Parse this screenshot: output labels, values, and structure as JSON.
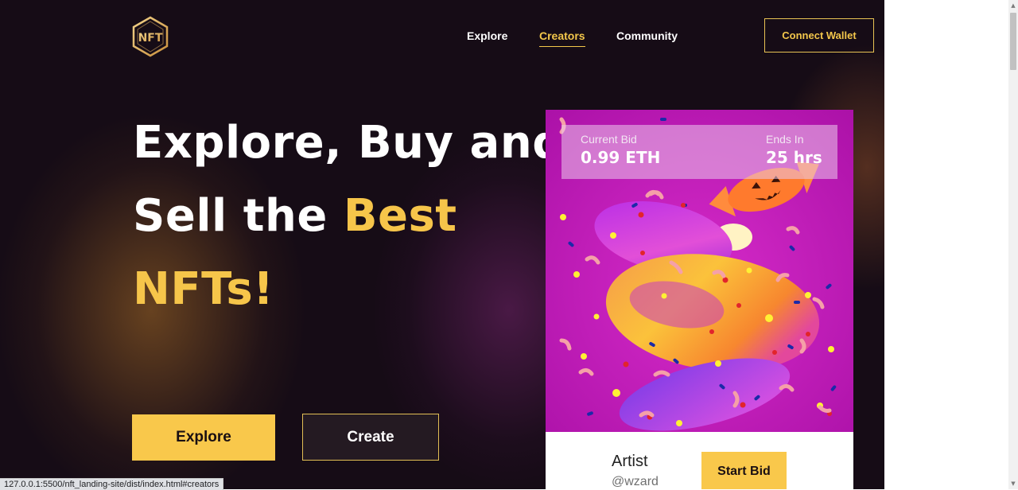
{
  "header": {
    "logo_text": "NFT",
    "nav": [
      {
        "label": "Explore",
        "active": false
      },
      {
        "label": "Creators",
        "active": true
      },
      {
        "label": "Community",
        "active": false
      }
    ],
    "connect_label": "Connect Wallet"
  },
  "hero": {
    "line1": "Explore, Buy and",
    "line2_plain": "Sell the ",
    "line2_highlight": "Best",
    "line3": "NFTs!",
    "explore_label": "Explore",
    "create_label": "Create"
  },
  "card": {
    "current_bid_label": "Current Bid",
    "current_bid_value": "0.99 ETH",
    "ends_in_label": "Ends In",
    "ends_in_value": "25 hrs",
    "artist_label": "Artist",
    "artist_handle": "@wzard",
    "start_bid_label": "Start Bid"
  },
  "status_url": "127.0.0.1:5500/nft_landing-site/dist/index.html#creators",
  "colors": {
    "accent": "#f6c54a",
    "background": "#160c16",
    "card_art_bg": "#c21fb7"
  }
}
